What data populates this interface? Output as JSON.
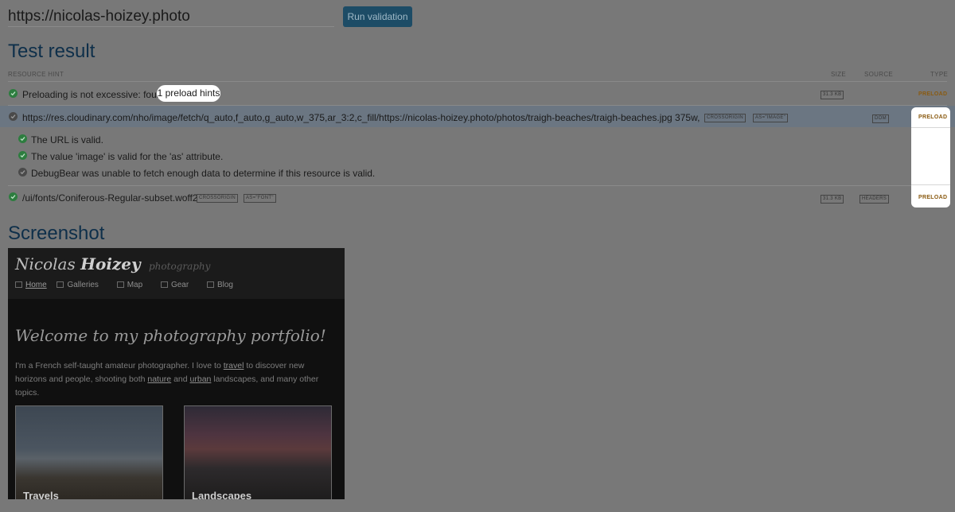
{
  "toolbar": {
    "url_value": "https://nicolas-hoizey.photo",
    "run_label": "Run validation"
  },
  "results": {
    "title": "Test result",
    "headers": {
      "resource_hint": "RESOURCE HINT",
      "size": "SIZE",
      "source": "SOURCE",
      "type": "TYPE"
    },
    "summary": {
      "text": "Preloading is not excessive: found",
      "highlight": "1 preload hints",
      "size": "31.3 KB",
      "type": "PRELOAD"
    },
    "hint1": {
      "url": "https://res.cloudinary.com/nho/image/fetch/q_auto,f_auto,g_auto,w_375,ar_3:2,c_fill/https://nicolas-hoizey.photo/photos/traigh-beaches/traigh-beaches.jpg 375w, https:...",
      "tags": [
        "CROSSORIGIN",
        "AS=\"IMAGE\""
      ],
      "source": "DOM",
      "type": "PRELOAD",
      "checks": [
        {
          "text": "The URL is valid.",
          "status": "ok"
        },
        {
          "text": "The value 'image' is valid for the 'as' attribute.",
          "status": "ok"
        },
        {
          "text": "DebugBear was unable to fetch enough data to determine if this resource is valid.",
          "status": "unknown"
        }
      ]
    },
    "hint2": {
      "url": "/ui/fonts/Coniferous-Regular-subset.woff2",
      "tags": [
        "CROSSORIGIN",
        "AS=\"FONT\""
      ],
      "size": "31.3 KB",
      "source": "HEADERS",
      "type": "PRELOAD"
    }
  },
  "screenshot": {
    "title": "Screenshot",
    "site": {
      "brand_first": "Nicolas",
      "brand_last": "Hoizey",
      "brand_sub": "photography",
      "nav": [
        "Home",
        "Galleries",
        "Map",
        "Gear",
        "Blog"
      ],
      "welcome": "Welcome to my photography portfolio!",
      "intro_parts": [
        "I'm a French self-taught amateur photographer. I love to ",
        "travel",
        " to discover new horizons and people, shooting both ",
        "nature",
        " and ",
        "urban",
        " landscapes, and many other topics."
      ],
      "cards": [
        "Travels",
        "Landscapes"
      ]
    }
  },
  "colors": {
    "accent_button": "#1d4c66",
    "heading": "#0e2f4a",
    "success": "#2d7d3f",
    "preload": "#8a5a10"
  }
}
